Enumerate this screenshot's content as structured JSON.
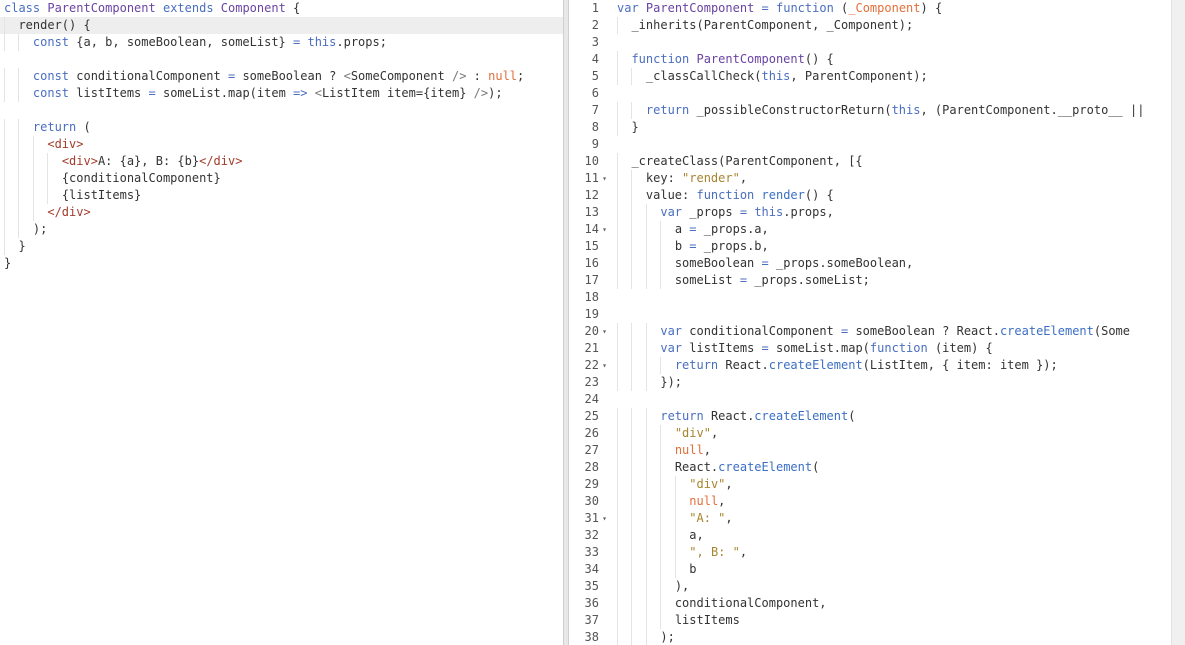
{
  "editor_left": {
    "lines": [
      "class ParentComponent extends Component {",
      "  render() {",
      "    const {a, b, someBoolean, someList} = this.props;",
      "",
      "    const conditionalComponent = someBoolean ? <SomeComponent /> : null;",
      "    const listItems = someList.map(item => <ListItem item={item} />);",
      "",
      "    return (",
      "      <div>",
      "        <div>A: {a}, B: {b}</div>",
      "        {conditionalComponent}",
      "        {listItems}",
      "      </div>",
      "    );",
      "  }",
      "}"
    ]
  },
  "editor_right": {
    "lines": [
      {
        "num": "1",
        "text": "var ParentComponent = function (_Component) {",
        "fold": false
      },
      {
        "num": "2",
        "text": "  _inherits(ParentComponent, _Component);",
        "fold": false
      },
      {
        "num": "3",
        "text": "",
        "fold": false
      },
      {
        "num": "4",
        "text": "  function ParentComponent() {",
        "fold": false
      },
      {
        "num": "5",
        "text": "    _classCallCheck(this, ParentComponent);",
        "fold": false
      },
      {
        "num": "6",
        "text": "",
        "fold": false
      },
      {
        "num": "7",
        "text": "    return _possibleConstructorReturn(this, (ParentComponent.__proto__ ||",
        "fold": false
      },
      {
        "num": "8",
        "text": "  }",
        "fold": false
      },
      {
        "num": "9",
        "text": "",
        "fold": false
      },
      {
        "num": "10",
        "text": "  _createClass(ParentComponent, [{",
        "fold": false
      },
      {
        "num": "11",
        "text": "    key: \"render\",",
        "fold": true
      },
      {
        "num": "12",
        "text": "    value: function render() {",
        "fold": false
      },
      {
        "num": "13",
        "text": "      var _props = this.props,",
        "fold": false
      },
      {
        "num": "14",
        "text": "        a = _props.a,",
        "fold": true
      },
      {
        "num": "15",
        "text": "        b = _props.b,",
        "fold": false
      },
      {
        "num": "16",
        "text": "        someBoolean = _props.someBoolean,",
        "fold": false
      },
      {
        "num": "17",
        "text": "        someList = _props.someList;",
        "fold": false
      },
      {
        "num": "18",
        "text": "",
        "fold": false
      },
      {
        "num": "19",
        "text": "",
        "fold": false
      },
      {
        "num": "20",
        "text": "      var conditionalComponent = someBoolean ? React.createElement(Some",
        "fold": true
      },
      {
        "num": "21",
        "text": "      var listItems = someList.map(function (item) {",
        "fold": false
      },
      {
        "num": "22",
        "text": "        return React.createElement(ListItem, { item: item });",
        "fold": true
      },
      {
        "num": "23",
        "text": "      });",
        "fold": false
      },
      {
        "num": "24",
        "text": "",
        "fold": false
      },
      {
        "num": "25",
        "text": "      return React.createElement(",
        "fold": false
      },
      {
        "num": "26",
        "text": "        \"div\",",
        "fold": false
      },
      {
        "num": "27",
        "text": "        null,",
        "fold": false
      },
      {
        "num": "28",
        "text": "        React.createElement(",
        "fold": false
      },
      {
        "num": "29",
        "text": "          \"div\",",
        "fold": false
      },
      {
        "num": "30",
        "text": "          null,",
        "fold": false
      },
      {
        "num": "31",
        "text": "          \"A: \",",
        "fold": true
      },
      {
        "num": "32",
        "text": "          a,",
        "fold": false
      },
      {
        "num": "33",
        "text": "          \", B: \",",
        "fold": false
      },
      {
        "num": "34",
        "text": "          b",
        "fold": false
      },
      {
        "num": "35",
        "text": "        ),",
        "fold": false
      },
      {
        "num": "36",
        "text": "        conditionalComponent,",
        "fold": false
      },
      {
        "num": "37",
        "text": "        listItems",
        "fold": false
      },
      {
        "num": "38",
        "text": "      );",
        "fold": false
      }
    ]
  },
  "colors": {
    "keyword": "#4a6ec0",
    "class_name": "#6a44a3",
    "string": "#a6852e",
    "null": "#e36f3a",
    "jsx_tag": "#a33d2d"
  }
}
